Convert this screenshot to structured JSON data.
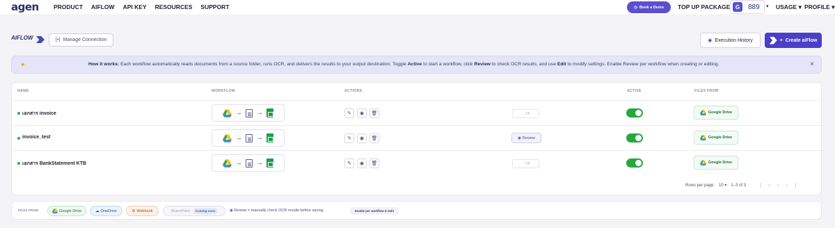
{
  "nav": {
    "logo_text": "agen",
    "links": [
      "PRODUCT",
      "AIFLOW",
      "API KEY",
      "RESOURCES",
      "SUPPORT"
    ],
    "book_demo": "Book a Demo",
    "top_up": "TOP UP PACKAGE",
    "credits": "889",
    "usage": "USAGE",
    "profile": "PROFILE"
  },
  "header": {
    "aiflow_logo": "AIFLOW",
    "manage_connection": "Manage Connection",
    "execution_history": "Execution History",
    "create_aiflow": "Create aiFlow"
  },
  "banner": {
    "how_label": "How it works:",
    "text_1": " Each workflow automatically reads documents from a source folder, runs OCR, and delivers the results to your output destination. Toggle ",
    "active": "Active",
    "text_2": " to start a workflow, click ",
    "review": "Review",
    "text_3": " to check OCR results, and use ",
    "edit": "Edit",
    "text_4": " to modify settings. Enable Review per workflow when creating or editing."
  },
  "table": {
    "headers": {
      "name": "NAME",
      "workflow": "WORKFLOW",
      "actions": "ACTIONS",
      "active": "ACTIVE",
      "files_from": "FILES FROM"
    },
    "rows": [
      {
        "name": "เอกสาร invoice",
        "review": "Off",
        "review_enabled": false,
        "active": true,
        "source": "Google Drive"
      },
      {
        "name": "invoice_test",
        "review": "Review",
        "review_enabled": true,
        "active": true,
        "source": "Google Drive"
      },
      {
        "name": "เอกสาร BankStatement KTB",
        "review": "Off",
        "review_enabled": false,
        "active": true,
        "source": "Google Drive"
      }
    ],
    "pager": {
      "rows_per_page_label": "Rows per page:",
      "rows_per_page": "10",
      "range": "1–3 of 3"
    }
  },
  "legend": {
    "label": "FILES FROM",
    "google_drive": "Google Drive",
    "onedrive": "OneDrive",
    "webhook": "Webhook",
    "sharepoint": "SharePoint",
    "coming_soon": "Coming soon",
    "review_note": "Review = manually check OCR results before saving",
    "enable_note": "Enable per workflow in Edit"
  },
  "colors": {
    "primary": "#4c3fc7",
    "active_green": "#27a83c",
    "banner_bg": "#e5e4f8"
  }
}
